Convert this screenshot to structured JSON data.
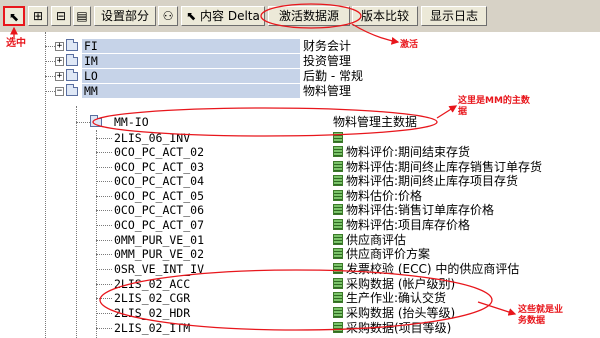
{
  "toolbar": {
    "buttons": [
      {
        "name": "select-node-button",
        "icon": "cursor-icon",
        "label": ""
      },
      {
        "name": "expand-all-button",
        "icon": "expand-tree-icon",
        "label": ""
      },
      {
        "name": "collapse-all-button",
        "icon": "collapse-tree-icon",
        "label": ""
      },
      {
        "name": "set-partial-button",
        "icon": "",
        "label": "设置部分"
      },
      {
        "name": "find-button",
        "icon": "binoculars-icon",
        "label": ""
      },
      {
        "name": "content-delta-button",
        "icon": "cursor-icon",
        "label": "内容 Delta"
      },
      {
        "name": "activate-datasource-button",
        "icon": "",
        "label": "激活数据源"
      },
      {
        "name": "version-compare-button",
        "icon": "",
        "label": "版本比较"
      },
      {
        "name": "show-log-button",
        "icon": "",
        "label": "显示日志"
      }
    ]
  },
  "tree": {
    "app_nodes": [
      {
        "code": "FI",
        "desc": "财务会计",
        "expander": "+"
      },
      {
        "code": "IM",
        "desc": "投资管理",
        "expander": "+"
      },
      {
        "code": "LO",
        "desc": "后勤 - 常规",
        "expander": "+"
      },
      {
        "code": "MM",
        "desc": "物料管理",
        "expander": "−"
      }
    ],
    "mm_io": {
      "code": "MM-IO",
      "desc": "物料管理主数据"
    },
    "datasources": [
      {
        "code": "2LIS_06_INV",
        "desc": ""
      },
      {
        "code": "0CO_PC_ACT_02",
        "desc": "物料评价:期间结束存货"
      },
      {
        "code": "0CO_PC_ACT_03",
        "desc": "物料评估:期间终止库存销售订单存货"
      },
      {
        "code": "0CO_PC_ACT_04",
        "desc": "物料评估:期间终止库存项目存货"
      },
      {
        "code": "0CO_PC_ACT_05",
        "desc": "物料估价:价格"
      },
      {
        "code": "0CO_PC_ACT_06",
        "desc": "物料评估:销售订单库存价格"
      },
      {
        "code": "0CO_PC_ACT_07",
        "desc": "物料评估:项目库存价格"
      },
      {
        "code": "0MM_PUR_VE_01",
        "desc": "供应商评估"
      },
      {
        "code": "0MM_PUR_VE_02",
        "desc": "供应商评价方案"
      },
      {
        "code": "0SR_VE_INT_IV",
        "desc": "发票校验 (ECC) 中的供应商评估"
      },
      {
        "code": "2LIS_02_ACC",
        "desc": "采购数据 (帐户级别)"
      },
      {
        "code": "2LIS_02_CGR",
        "desc": "生产作业:确认交货"
      },
      {
        "code": "2LIS_02_HDR",
        "desc": "采购数据 (抬头等级)"
      },
      {
        "code": "2LIS_02_ITM",
        "desc": "采购数据(项目等级)"
      }
    ]
  },
  "annotations": {
    "select_label": "选中",
    "activate_label": "激活",
    "mm_master_line1": "这里是MM的主数",
    "mm_master_line2": "据",
    "business_line1": "这些就是业",
    "business_line2": "务数据"
  },
  "colors": {
    "toolbar_bg": "#d7d2c6",
    "button_bg": "#ece9d8",
    "annotation_red": "#e8161c",
    "selected_node_bg": "#c6d3e8"
  }
}
